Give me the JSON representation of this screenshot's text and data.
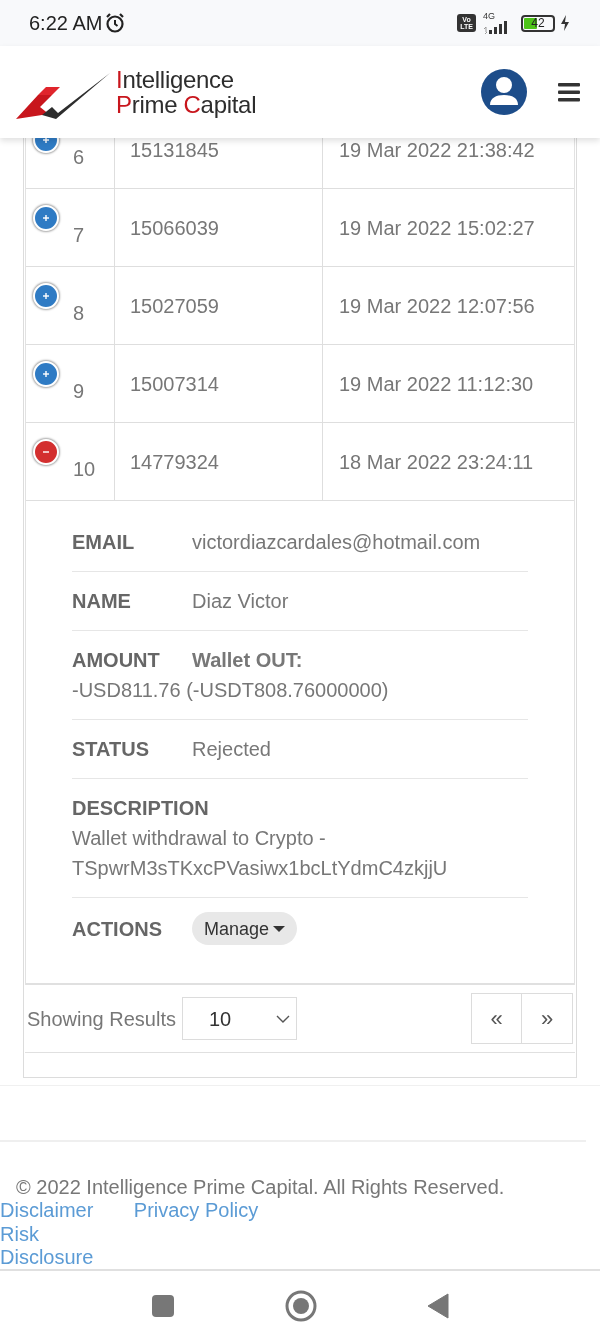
{
  "status_bar": {
    "time": "6:22 AM",
    "network_badge": [
      "Vo",
      "LTE"
    ],
    "network_type": "4G",
    "battery": "42"
  },
  "header": {
    "logo_lines": [
      [
        {
          "text": "I",
          "accent": true
        },
        {
          "text": "ntelligence",
          "accent": false
        }
      ],
      [
        {
          "text": "P",
          "accent": true
        },
        {
          "text": "rime ",
          "accent": false
        },
        {
          "text": "C",
          "accent": true
        },
        {
          "text": "apital",
          "accent": false
        }
      ]
    ]
  },
  "table": {
    "rows": [
      {
        "index": "6",
        "id": "15131845",
        "date": "19 Mar 2022 21:38:42",
        "expanded": false
      },
      {
        "index": "7",
        "id": "15066039",
        "date": "19 Mar 2022 15:02:27",
        "expanded": false
      },
      {
        "index": "8",
        "id": "15027059",
        "date": "19 Mar 2022 12:07:56",
        "expanded": false
      },
      {
        "index": "9",
        "id": "15007314",
        "date": "19 Mar 2022 11:12:30",
        "expanded": false
      },
      {
        "index": "10",
        "id": "14779324",
        "date": "18 Mar 2022 23:24:11",
        "expanded": true
      }
    ],
    "details": [
      {
        "kind": "inline",
        "label": "EMAIL",
        "lines": [
          "victordiazcardales@hotmail.com"
        ]
      },
      {
        "kind": "inline",
        "label": "NAME",
        "lines": [
          "Diaz Victor"
        ]
      },
      {
        "kind": "inline",
        "label": "AMOUNT",
        "lines": [
          "**Wallet OUT:**",
          "-USD811.76 (-USDT808.76000000)"
        ]
      },
      {
        "kind": "inline",
        "label": "STATUS",
        "lines": [
          "Rejected"
        ]
      },
      {
        "kind": "block",
        "label": "DESCRIPTION",
        "lines": [
          "Wallet withdrawal to Crypto -",
          "TSpwrM3sTKxcPVasiwx1bcLtYdmC4zkjjU"
        ]
      },
      {
        "kind": "action",
        "label": "ACTIONS",
        "button": "Manage"
      }
    ]
  },
  "pagination": {
    "label": "Showing Results",
    "page_size": "10",
    "prev": "«",
    "next": "»"
  },
  "footer": {
    "copyright": "© 2022 Intelligence Prime Capital. All Rights Reserved.",
    "links": [
      "Disclaimer",
      "Privacy Policy",
      "Risk Disclosure"
    ]
  }
}
